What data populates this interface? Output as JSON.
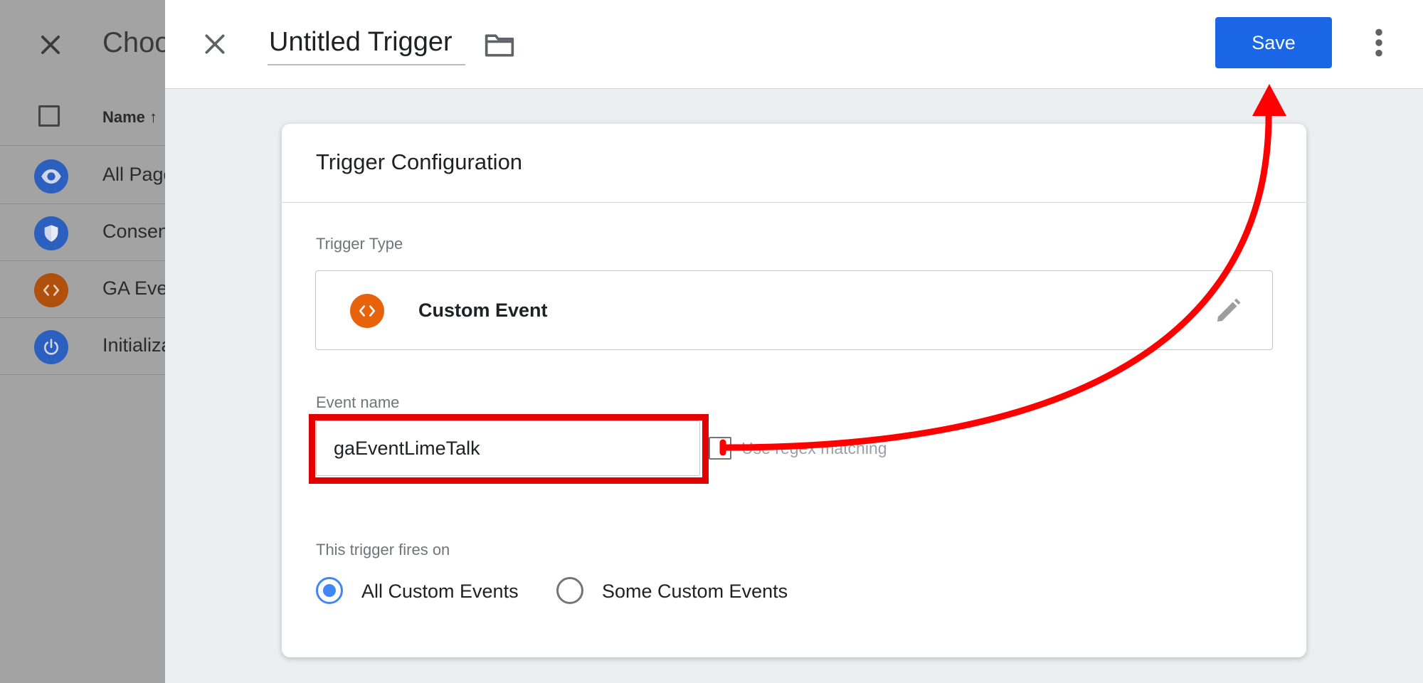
{
  "background_list": {
    "title": "Choose a trigger",
    "column_name": "Name ↑",
    "rows": [
      {
        "label": "All Pages",
        "icon": "eye-icon",
        "color": "#2d5fbf"
      },
      {
        "label": "Consent Initialization - All Pages",
        "icon": "shield-icon",
        "color": "#2d5fbf"
      },
      {
        "label": "GA Event",
        "icon": "code-icon",
        "color": "#b0500d"
      },
      {
        "label": "Initialization - All Pages",
        "icon": "power-icon",
        "color": "#2d5fbf"
      }
    ]
  },
  "header": {
    "title_value": "Untitled Trigger",
    "save_label": "Save"
  },
  "card": {
    "title": "Trigger Configuration",
    "trigger_type_label": "Trigger Type",
    "trigger_type": "Custom Event",
    "event_name_label": "Event name",
    "event_name_value": "gaEventLimeTalk",
    "regex_label": "Use regex matching",
    "fires_on_label": "This trigger fires on",
    "fires_on_options": [
      {
        "label": "All Custom Events",
        "selected": true
      },
      {
        "label": "Some Custom Events",
        "selected": false
      }
    ]
  },
  "colors": {
    "accent": "#1a66e6",
    "custom_event_icon": "#e8620c",
    "annotation": "#e30000",
    "radio_selected": "#4285f4"
  }
}
